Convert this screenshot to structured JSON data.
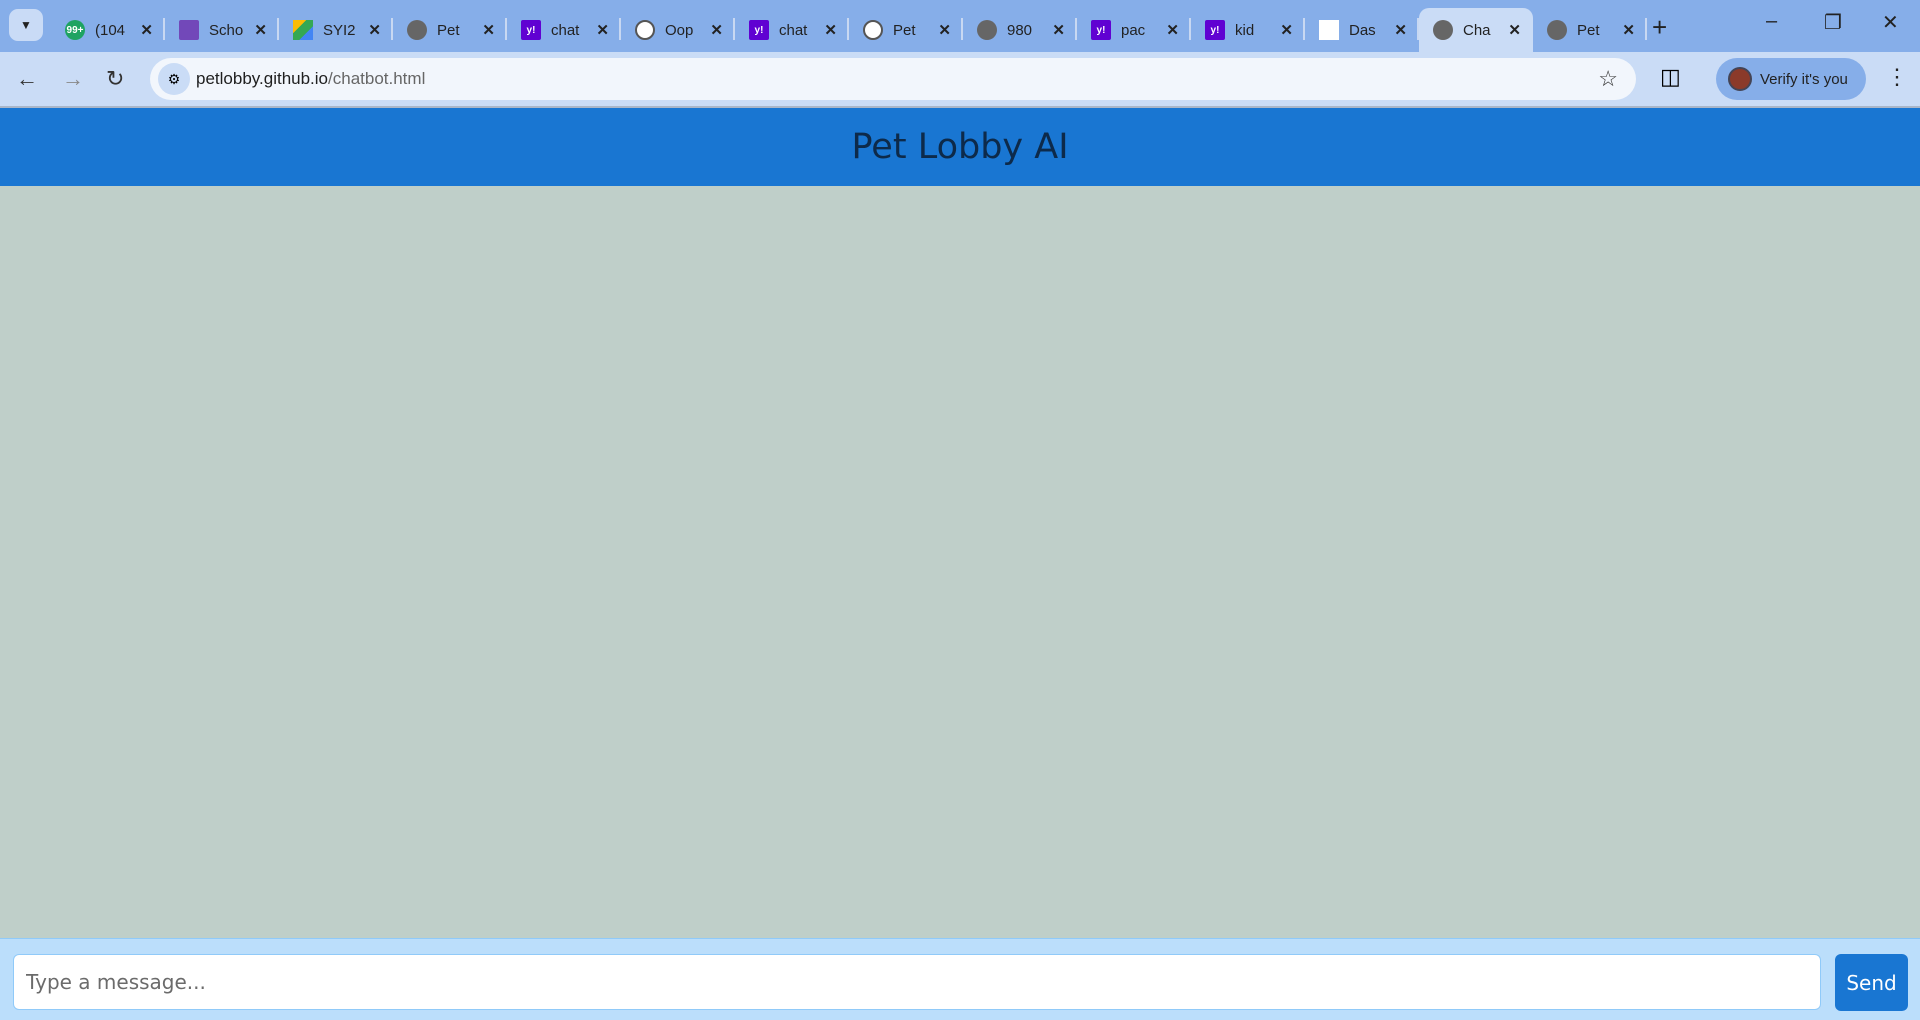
{
  "browser": {
    "tabs": [
      {
        "label": "(104",
        "icon": "chat-badge-icon",
        "fav": "g",
        "badge": "99+"
      },
      {
        "label": "Scho",
        "icon": "forms-icon",
        "fav": "f"
      },
      {
        "label": "SYI2",
        "icon": "drive-icon",
        "fav": "d"
      },
      {
        "label": "Pet",
        "icon": "globe-icon",
        "fav": ""
      },
      {
        "label": "chat",
        "icon": "yahoo-icon",
        "fav": "y",
        "badge": "y!"
      },
      {
        "label": "Oop",
        "icon": "openai-icon",
        "fav": "o"
      },
      {
        "label": "chat",
        "icon": "yahoo-icon",
        "fav": "y",
        "badge": "y!"
      },
      {
        "label": "Pet",
        "icon": "openai-icon",
        "fav": "o"
      },
      {
        "label": "980",
        "icon": "globe-icon",
        "fav": ""
      },
      {
        "label": "pac",
        "icon": "yahoo-icon",
        "fav": "y",
        "badge": "y!"
      },
      {
        "label": "kid",
        "icon": "yahoo-icon",
        "fav": "y",
        "badge": "y!"
      },
      {
        "label": "Das",
        "icon": "dashboard-icon",
        "fav": "w"
      },
      {
        "label": "Cha",
        "icon": "globe-icon",
        "fav": "",
        "active": true
      },
      {
        "label": "Pet",
        "icon": "globe-icon",
        "fav": ""
      }
    ],
    "url_host": "petlobby.github.io",
    "url_path": "/chatbot.html",
    "profile_label": "Verify it's you"
  },
  "app": {
    "title": "Pet Lobby AI",
    "input_placeholder": "Type a message...",
    "input_value": "",
    "send_label": "Send"
  },
  "colors": {
    "header": "#1976d2",
    "chat_bg": "#bfcfc9",
    "input_bar": "#bbdefb",
    "send": "#1976d2"
  }
}
